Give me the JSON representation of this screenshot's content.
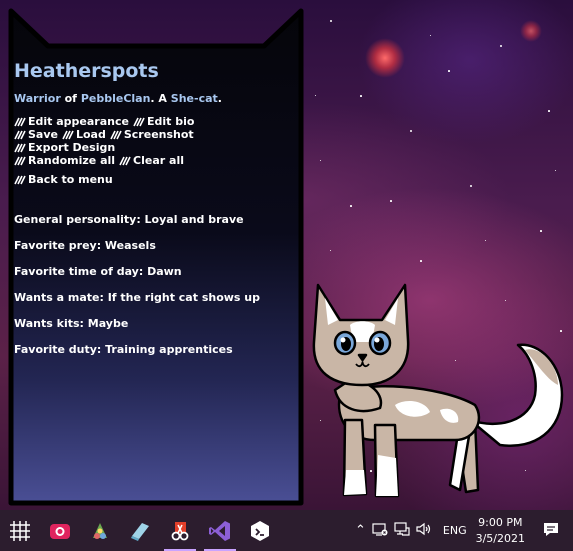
{
  "cat": {
    "name": "Heatherspots",
    "rank": "Warrior",
    "of_word": "of",
    "clan": "PebbleClan",
    "article": ". A",
    "gender": "She-cat",
    "period": "."
  },
  "menu": {
    "edit_appearance": "Edit appearance",
    "edit_bio": "Edit bio",
    "save": "Save",
    "load": "Load",
    "screenshot": "Screenshot",
    "export_design": "Export Design",
    "randomize_all": "Randomize all",
    "clear_all": "Clear all",
    "back_to_menu": "Back to menu"
  },
  "bio": [
    "General personality: Loyal and brave",
    "Favorite prey: Weasels",
    "Favorite time of day: Dawn",
    "Wants a mate: If the right cat shows up",
    "Wants kits: Maybe",
    "Favorite duty: Training apprentices"
  ],
  "taskbar": {
    "apps": [
      "grid-icon",
      "camera-app-icon",
      "paint-app-icon",
      "notepad-app-icon",
      "snipping-app-icon",
      "visual-studio-icon",
      "dev-app-icon"
    ],
    "language": "ENG",
    "time": "9:00 PM",
    "date": "3/5/2021"
  },
  "colors": {
    "title": "#a9c8f0",
    "panel": "#05050a",
    "taskbar": "#2c1d2e"
  }
}
